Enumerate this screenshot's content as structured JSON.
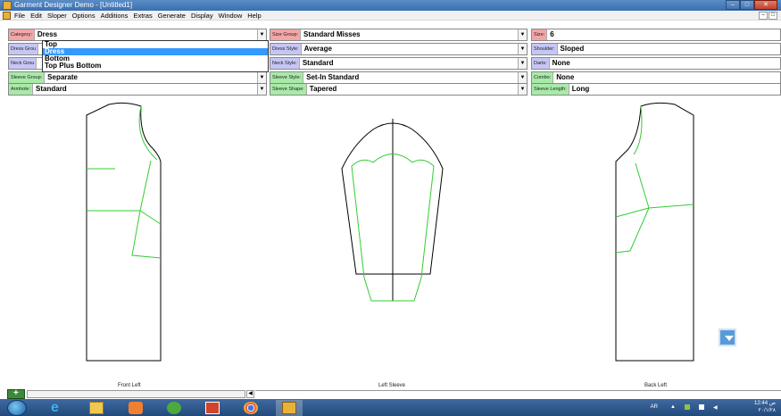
{
  "window": {
    "title": "Garment Designer Demo - [Untitled1]",
    "buttons": [
      "–",
      "□",
      "✕"
    ]
  },
  "menu": {
    "items": [
      "File",
      "Edit",
      "Sloper",
      "Options",
      "Additions",
      "Extras",
      "Generate",
      "Display",
      "Window",
      "Help"
    ],
    "mdi_buttons": [
      "–",
      "□"
    ]
  },
  "options": {
    "category": {
      "label": "Category:",
      "value": "Dress"
    },
    "size_group": {
      "label": "Size Group:",
      "value": "Standard Misses"
    },
    "size": {
      "label": "Size:",
      "value": "6"
    },
    "dress_group": {
      "label": "Dress Grou",
      "value": ""
    },
    "dress_style": {
      "label": "Dress Style:",
      "value": "Average"
    },
    "shoulder": {
      "label": "Shoulder:",
      "value": "Sloped"
    },
    "neck_group": {
      "label": "Neck Grou",
      "value": ""
    },
    "neck_style": {
      "label": "Neck Style:",
      "value": "Standard"
    },
    "darts": {
      "label": "Darts:",
      "value": "None"
    },
    "sleeve_group": {
      "label": "Sleeve Group:",
      "value": "Separate"
    },
    "sleeve_style": {
      "label": "Sleeve Style:",
      "value": "Set-In Standard"
    },
    "combo": {
      "label": "Combo:",
      "value": "None"
    },
    "armhole": {
      "label": "Armhole:",
      "value": "Standard"
    },
    "sleeve_shape": {
      "label": "Sleeve Shape:",
      "value": "Tapered"
    },
    "sleeve_length": {
      "label": "Sleeve Length:",
      "value": "Long"
    }
  },
  "dropdown": {
    "items": [
      "Top",
      "Dress",
      "Bottom",
      "Top Plus Bottom"
    ],
    "selected": "Dress"
  },
  "pieces": {
    "front_left": "Front Left",
    "left_sleeve": "Left Sleeve",
    "back_left": "Back Left"
  },
  "taskbar": {
    "lang": "AR",
    "time": "12:44 ص",
    "date": "٢٠/١/٢٨"
  },
  "colors": {
    "pattern_outline": "#000000",
    "pattern_inner": "#33cc33",
    "category_label": "#f3a6a6",
    "group_label": "#c6c6f6",
    "style_label": "#a8eaa8",
    "selection": "#3399ff"
  }
}
